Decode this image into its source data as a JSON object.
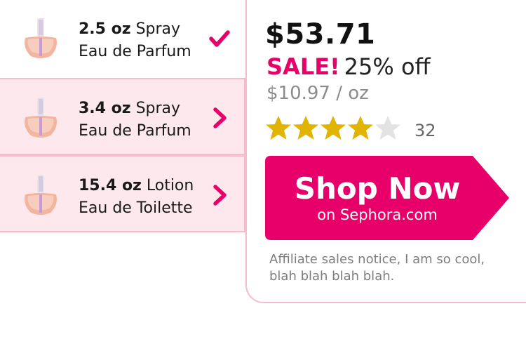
{
  "variants": [
    {
      "size": "2.5 oz",
      "form": "Spray",
      "type": "Eau de Parfum",
      "state_icon": "checkmark-icon"
    },
    {
      "size": "3.4 oz",
      "form": "Spray",
      "type": "Eau de Parfum",
      "state_icon": "chevron-right-icon"
    },
    {
      "size": "15.4 oz",
      "form": "Lotion",
      "type": "Eau de Toilette",
      "state_icon": "chevron-right-icon"
    }
  ],
  "product": {
    "price": "$53.71",
    "sale_label": "SALE!",
    "sale_percent": "25% off",
    "unit_price": "$10.97 / oz",
    "rating": 4,
    "rating_max": 5,
    "review_count": "32"
  },
  "cta": {
    "title": "Shop Now",
    "subtitle": "on Sephora.com"
  },
  "notice": "Affiliate sales notice, I am so cool, blah blah blah blah.",
  "colors": {
    "accent": "#e8006a",
    "selected_bg": "#ffffff",
    "unselected_bg": "#fde8ee",
    "border": "#f6bccd",
    "star_filled": "#e0b400",
    "star_empty": "#e3e3e3"
  }
}
